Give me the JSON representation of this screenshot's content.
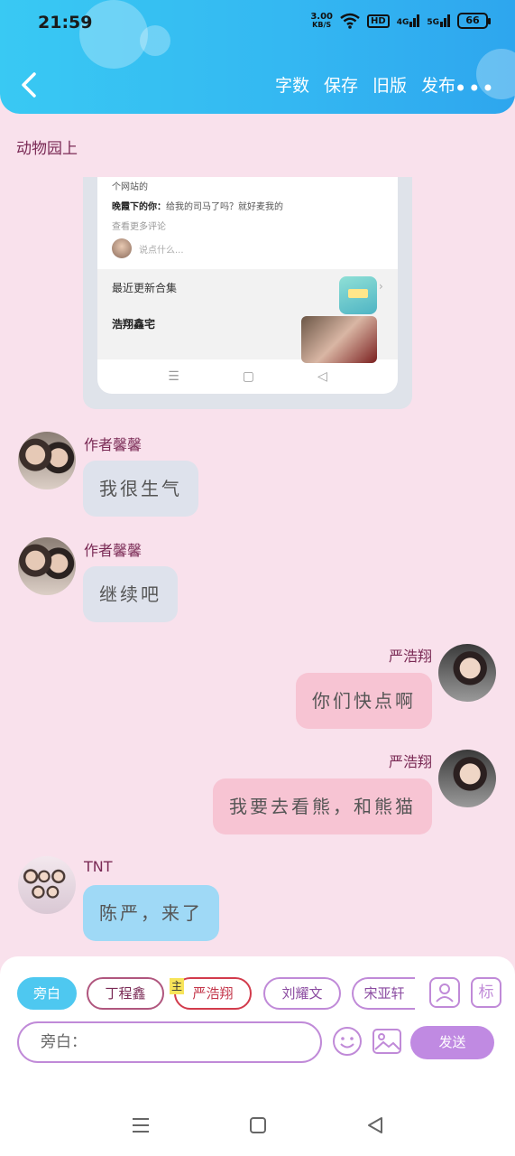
{
  "status_bar": {
    "time": "21:59",
    "speed": "3.00",
    "speed_unit": "KB/S",
    "hd": "HD",
    "signal_4g": "4G",
    "signal_5g": "5G",
    "battery": "66"
  },
  "header": {
    "actions": [
      "字数",
      "保存",
      "旧版",
      "发布"
    ],
    "more": "•••"
  },
  "section_title": "动物园上",
  "embedded_shot": {
    "comment_line1": "个网站的",
    "comment_line2_name": "晚霞下的你：",
    "comment_line2_text": "给我的司马了吗？就好麦我的",
    "more_comments": "查看更多评论",
    "comment_placeholder": "说点什么...",
    "recent_title": "最近更新合集",
    "recent_name": "浩翔鑫宅"
  },
  "messages": [
    {
      "name": "作者馨馨",
      "text": "我很生气"
    },
    {
      "name": "作者馨馨",
      "text": "继续吧"
    },
    {
      "name": "严浩翔",
      "text": "你们快点啊"
    },
    {
      "name": "严浩翔",
      "text": "我要去看熊，和熊猫"
    },
    {
      "name": "TNT",
      "text": "陈严，来了"
    }
  ],
  "bottom": {
    "chips": [
      "旁白",
      "丁程鑫",
      "严浩翔",
      "刘耀文",
      "宋亚轩"
    ],
    "lead_tag": "主",
    "tag_button": "标",
    "input_placeholder": "旁白：",
    "send": "发送"
  }
}
